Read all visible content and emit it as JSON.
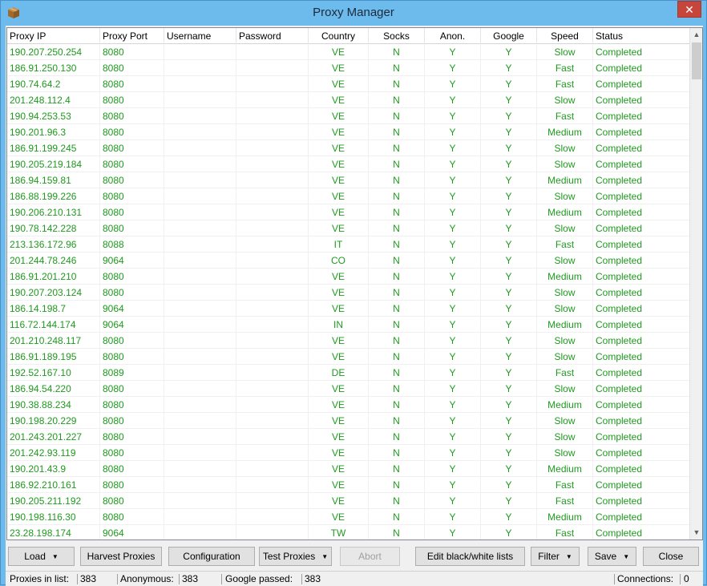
{
  "window": {
    "title": "Proxy Manager",
    "close_glyph": "✕",
    "icon": "package-icon"
  },
  "columns": [
    "Proxy IP",
    "Proxy Port",
    "Username",
    "Password",
    "Country",
    "Socks",
    "Anon.",
    "Google",
    "Speed",
    "Status"
  ],
  "rows": [
    [
      "190.207.250.254",
      "8080",
      "",
      "",
      "VE",
      "N",
      "Y",
      "Y",
      "Slow",
      "Completed"
    ],
    [
      "186.91.250.130",
      "8080",
      "",
      "",
      "VE",
      "N",
      "Y",
      "Y",
      "Fast",
      "Completed"
    ],
    [
      "190.74.64.2",
      "8080",
      "",
      "",
      "VE",
      "N",
      "Y",
      "Y",
      "Fast",
      "Completed"
    ],
    [
      "201.248.112.4",
      "8080",
      "",
      "",
      "VE",
      "N",
      "Y",
      "Y",
      "Slow",
      "Completed"
    ],
    [
      "190.94.253.53",
      "8080",
      "",
      "",
      "VE",
      "N",
      "Y",
      "Y",
      "Fast",
      "Completed"
    ],
    [
      "190.201.96.3",
      "8080",
      "",
      "",
      "VE",
      "N",
      "Y",
      "Y",
      "Medium",
      "Completed"
    ],
    [
      "186.91.199.245",
      "8080",
      "",
      "",
      "VE",
      "N",
      "Y",
      "Y",
      "Slow",
      "Completed"
    ],
    [
      "190.205.219.184",
      "8080",
      "",
      "",
      "VE",
      "N",
      "Y",
      "Y",
      "Slow",
      "Completed"
    ],
    [
      "186.94.159.81",
      "8080",
      "",
      "",
      "VE",
      "N",
      "Y",
      "Y",
      "Medium",
      "Completed"
    ],
    [
      "186.88.199.226",
      "8080",
      "",
      "",
      "VE",
      "N",
      "Y",
      "Y",
      "Slow",
      "Completed"
    ],
    [
      "190.206.210.131",
      "8080",
      "",
      "",
      "VE",
      "N",
      "Y",
      "Y",
      "Medium",
      "Completed"
    ],
    [
      "190.78.142.228",
      "8080",
      "",
      "",
      "VE",
      "N",
      "Y",
      "Y",
      "Slow",
      "Completed"
    ],
    [
      "213.136.172.96",
      "8088",
      "",
      "",
      "IT",
      "N",
      "Y",
      "Y",
      "Fast",
      "Completed"
    ],
    [
      "201.244.78.246",
      "9064",
      "",
      "",
      "CO",
      "N",
      "Y",
      "Y",
      "Slow",
      "Completed"
    ],
    [
      "186.91.201.210",
      "8080",
      "",
      "",
      "VE",
      "N",
      "Y",
      "Y",
      "Medium",
      "Completed"
    ],
    [
      "190.207.203.124",
      "8080",
      "",
      "",
      "VE",
      "N",
      "Y",
      "Y",
      "Slow",
      "Completed"
    ],
    [
      "186.14.198.7",
      "9064",
      "",
      "",
      "VE",
      "N",
      "Y",
      "Y",
      "Slow",
      "Completed"
    ],
    [
      "116.72.144.174",
      "9064",
      "",
      "",
      "IN",
      "N",
      "Y",
      "Y",
      "Medium",
      "Completed"
    ],
    [
      "201.210.248.117",
      "8080",
      "",
      "",
      "VE",
      "N",
      "Y",
      "Y",
      "Slow",
      "Completed"
    ],
    [
      "186.91.189.195",
      "8080",
      "",
      "",
      "VE",
      "N",
      "Y",
      "Y",
      "Slow",
      "Completed"
    ],
    [
      "192.52.167.10",
      "8089",
      "",
      "",
      "DE",
      "N",
      "Y",
      "Y",
      "Fast",
      "Completed"
    ],
    [
      "186.94.54.220",
      "8080",
      "",
      "",
      "VE",
      "N",
      "Y",
      "Y",
      "Slow",
      "Completed"
    ],
    [
      "190.38.88.234",
      "8080",
      "",
      "",
      "VE",
      "N",
      "Y",
      "Y",
      "Medium",
      "Completed"
    ],
    [
      "190.198.20.229",
      "8080",
      "",
      "",
      "VE",
      "N",
      "Y",
      "Y",
      "Slow",
      "Completed"
    ],
    [
      "201.243.201.227",
      "8080",
      "",
      "",
      "VE",
      "N",
      "Y",
      "Y",
      "Slow",
      "Completed"
    ],
    [
      "201.242.93.119",
      "8080",
      "",
      "",
      "VE",
      "N",
      "Y",
      "Y",
      "Slow",
      "Completed"
    ],
    [
      "190.201.43.9",
      "8080",
      "",
      "",
      "VE",
      "N",
      "Y",
      "Y",
      "Medium",
      "Completed"
    ],
    [
      "186.92.210.161",
      "8080",
      "",
      "",
      "VE",
      "N",
      "Y",
      "Y",
      "Fast",
      "Completed"
    ],
    [
      "190.205.211.192",
      "8080",
      "",
      "",
      "VE",
      "N",
      "Y",
      "Y",
      "Fast",
      "Completed"
    ],
    [
      "190.198.116.30",
      "8080",
      "",
      "",
      "VE",
      "N",
      "Y",
      "Y",
      "Medium",
      "Completed"
    ],
    [
      "23.28.198.174",
      "9064",
      "",
      "",
      "TW",
      "N",
      "Y",
      "Y",
      "Fast",
      "Completed"
    ]
  ],
  "toolbar": {
    "load": "Load",
    "harvest": "Harvest Proxies",
    "configuration": "Configuration",
    "test": "Test Proxies",
    "abort": "Abort",
    "edit_lists": "Edit black/white lists",
    "filter": "Filter",
    "save": "Save",
    "close": "Close",
    "dropdown_glyph": "▼"
  },
  "scroll_glyphs": {
    "up": "▲",
    "down": "▼"
  },
  "status": {
    "proxies_label": "Proxies in list:",
    "proxies_value": "383",
    "anonymous_label": "Anonymous:",
    "anonymous_value": "383",
    "google_label": "Google passed:",
    "google_value": "383",
    "connections_label": "Connections:",
    "connections_value": "0"
  },
  "colors": {
    "text_green": "#1e9a1e",
    "title_bg": "#6dbaec",
    "close_red": "#c7463c"
  }
}
